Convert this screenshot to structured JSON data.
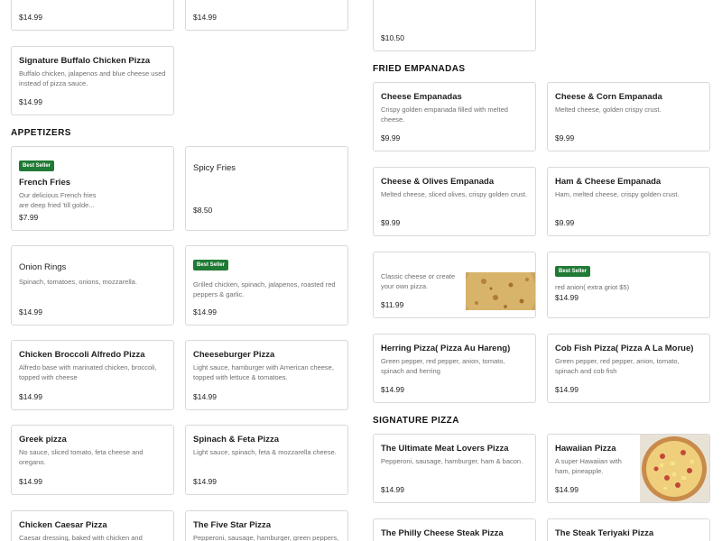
{
  "left": {
    "top_cards": [
      {
        "price": "$14.99"
      },
      {
        "price": "$14.99"
      }
    ],
    "buffalo": {
      "title": "Signature Buffalo Chicken Pizza",
      "desc": "Buffalo chicken, jalapenos and blue cheese used instead of pizza sauce.",
      "price": "$14.99"
    },
    "appetizers_title": "APPETIZERS",
    "french_fries": {
      "badge": "Best Seller",
      "title": "French Fries",
      "desc_line1": "Our delicious French fries",
      "desc_line2": "are deep fried 'till golde...",
      "price": "$7.99"
    },
    "spicy_fries": {
      "title": "Spicy Fries",
      "price": "$8.50"
    },
    "onion_rings": {
      "title": "Onion Rings",
      "desc": "Spinach, tomatoes, onions, mozzarella.",
      "price": "$14.99"
    },
    "grilled_card": {
      "badge": "Best Seller",
      "desc": "Grilled chicken, spinach, jalapenos, roasted red peppers & garlic.",
      "price": "$14.99"
    },
    "broccoli": {
      "title": "Chicken Broccoli Alfredo Pizza",
      "desc": "Alfredo base with marinated chicken, broccoli, topped with cheese",
      "price": "$14.99"
    },
    "cheeseburger": {
      "title": "Cheeseburger Pizza",
      "desc": "Light sauce, hamburger with American cheese, topped with lettuce & tomatoes.",
      "price": "$14.99"
    },
    "greek": {
      "title": "Greek pizza",
      "desc": "No sauce, sliced tomato, feta cheese and oregano.",
      "price": "$14.99"
    },
    "spinach_feta": {
      "title": "Spinach & Feta Pizza",
      "desc": "Light sauce, spinach, feta & mozzarella cheese.",
      "price": "$14.99"
    },
    "caesar": {
      "title": "Chicken Caesar Pizza",
      "desc": "Caesar dressing, baked with chicken and cheese,"
    },
    "five_star": {
      "title": "The Five Star Pizza",
      "desc": "Pepperoni, sausage, hamburger, green peppers,"
    }
  },
  "right": {
    "top_card": {
      "price": "$10.50"
    },
    "empanadas_title": "FRIED EMPANADAS",
    "cheese_emp": {
      "title": "Cheese Empanadas",
      "desc": "Crispy golden empanada filled with melted cheese.",
      "price": "$9.99"
    },
    "corn_emp": {
      "title": "Cheese & Corn Empanada",
      "desc": "Melted cheese, golden crispy crust.",
      "price": "$9.99"
    },
    "olives_emp": {
      "title": "Cheese & Olives Empanada",
      "desc": "Melted cheese, sliced olives, crispy golden crust.",
      "price": "$9.99"
    },
    "ham_emp": {
      "title": "Ham & Cheese Empanada",
      "desc": "Ham, melted cheese, crispy golden crust.",
      "price": "$9.99"
    },
    "classic": {
      "desc_line1": "Classic cheese or create",
      "desc_line2": "your own pizza.",
      "price": "$11.99"
    },
    "onion_card": {
      "badge": "Best Seller",
      "desc": "red anion( extra griot $5)",
      "price": "$14.99"
    },
    "herring": {
      "title": "Herring Pizza( Pizza Au Hareng)",
      "desc": "Green pepper, red pepper, anion, tomato, spinach and herring",
      "price": "$14.99"
    },
    "cod": {
      "title": "Cob Fish Pizza( Pizza A La Morue)",
      "desc": "Green pepper, red pepper, anion, tomato, spinach and cob fish",
      "price": "$14.99"
    },
    "signature_title": "SIGNATURE PIZZA",
    "meat_lovers": {
      "title": "The Ultimate Meat Lovers Pizza",
      "desc": "Pepperoni, sausage, hamburger, ham & bacon.",
      "price": "$14.99"
    },
    "hawaiian": {
      "title": "Hawaiian Pizza",
      "desc_line1": "A super Hawaiian with",
      "desc_line2": "ham, pineapple.",
      "price": "$14.99"
    },
    "philly": {
      "title": "The Philly Cheese Steak Pizza"
    },
    "teriyaki": {
      "title": "The Steak Teriyaki Pizza"
    }
  },
  "colors": {
    "badge": "#1e7a34",
    "border": "#d9d9d9",
    "desc": "#6f6f6f"
  }
}
